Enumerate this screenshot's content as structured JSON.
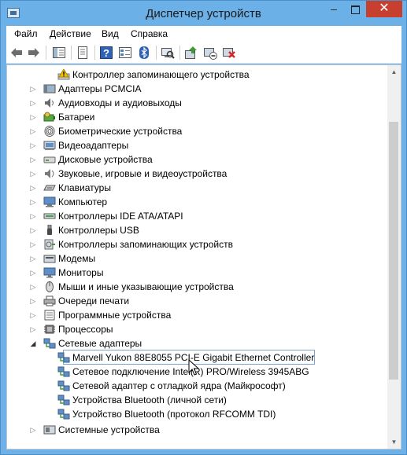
{
  "window": {
    "title": "Диспетчер устройств",
    "minimize_label": "–",
    "close_label": "✕"
  },
  "menu": [
    "Файл",
    "Действие",
    "Вид",
    "Справка"
  ],
  "toolbar": {
    "buttons": [
      "back-icon",
      "forward-icon",
      "show-hide-tree-icon",
      "properties-icon",
      "help-icon",
      "view-icon",
      "bluetooth-icon",
      "scan-hardware-icon",
      "update-driver-icon",
      "disable-device-icon",
      "uninstall-device-icon"
    ]
  },
  "tree": {
    "top_item": "Контроллер запоминающего устройства",
    "categories": [
      "Адаптеры PCMCIA",
      "Аудиовходы и аудиовыходы",
      "Батареи",
      "Биометрические устройства",
      "Видеоадаптеры",
      "Дисковые устройства",
      "Звуковые, игровые и видеоустройства",
      "Клавиатуры",
      "Компьютер",
      "Контроллеры IDE ATA/ATAPI",
      "Контроллеры USB",
      "Контроллеры запоминающих устройств",
      "Модемы",
      "Мониторы",
      "Мыши и иные указывающие устройства",
      "Очереди печати",
      "Программные устройства",
      "Процессоры"
    ],
    "expanded_category": "Сетевые адаптеры",
    "network_adapters": [
      "Marvell Yukon 88E8055 PCI-E Gigabit Ethernet Controller",
      "Сетевое подключение Intel(R) PRO/Wireless 3945ABG",
      "Сетевой адаптер с отладкой ядра (Майкрософт)",
      "Устройства Bluetooth (личной сети)",
      "Устройство Bluetooth (протокол RFCOMM TDI)"
    ],
    "last_category": "Системные устройства"
  },
  "colors": {
    "titlebar": "#6cb0e8",
    "close_button": "#c7402f",
    "selection_border": "#7da2ce"
  }
}
